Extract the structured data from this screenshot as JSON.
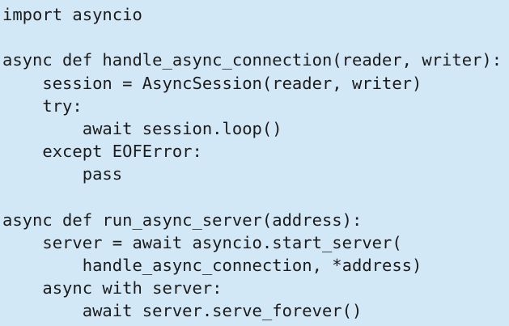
{
  "code": {
    "lines": [
      "import asyncio",
      "",
      "async def handle_async_connection(reader, writer):",
      "    session = AsyncSession(reader, writer)",
      "    try:",
      "        await session.loop()",
      "    except EOFError:",
      "        pass",
      "",
      "async def run_async_server(address):",
      "    server = await asyncio.start_server(",
      "        handle_async_connection, *address)",
      "    async with server:",
      "        await server.serve_forever()"
    ]
  }
}
